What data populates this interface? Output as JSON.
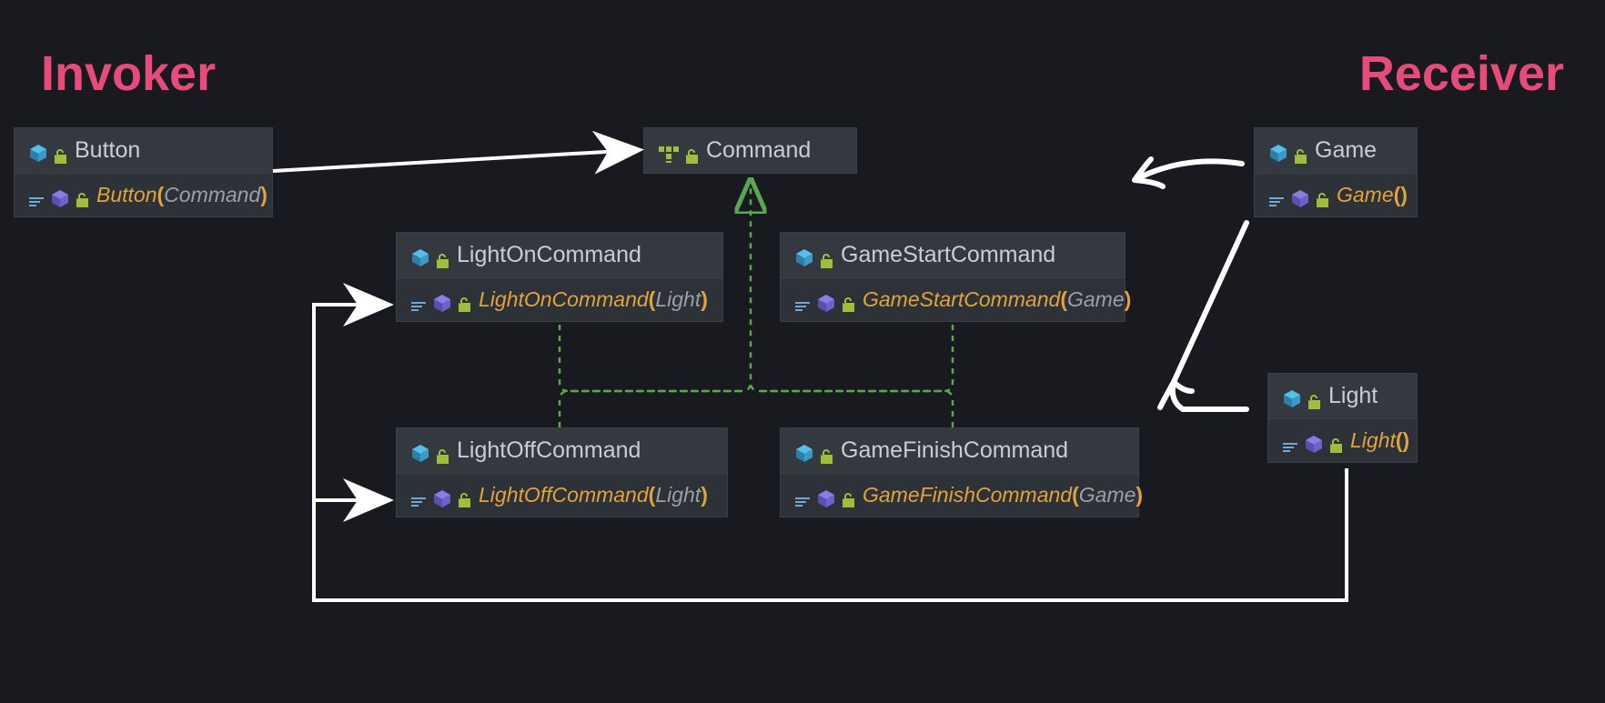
{
  "labels": {
    "invoker": "Invoker",
    "receiver": "Receiver"
  },
  "button": {
    "title": "Button",
    "ctor_name": "Button",
    "ctor_param": "Command"
  },
  "command": {
    "title": "Command"
  },
  "lightOn": {
    "title": "LightOnCommand",
    "ctor_name": "LightOnCommand",
    "ctor_param": "Light"
  },
  "lightOff": {
    "title": "LightOffCommand",
    "ctor_name": "LightOffCommand",
    "ctor_param": "Light"
  },
  "gameStart": {
    "title": "GameStartCommand",
    "ctor_name": "GameStartCommand",
    "ctor_param": "Game"
  },
  "gameFinish": {
    "title": "GameFinishCommand",
    "ctor_name": "GameFinishCommand",
    "ctor_param": "Game"
  },
  "game": {
    "title": "Game",
    "ctor_name": "Game"
  },
  "light": {
    "title": "Light",
    "ctor_name": "Light"
  },
  "colors": {
    "accent_pink": "#e84a7a",
    "method_orange": "#e2a33a",
    "cube_blue": "#3fa7d6",
    "lock_green": "#9fbf3a",
    "inherit_green": "#5aa84e"
  }
}
